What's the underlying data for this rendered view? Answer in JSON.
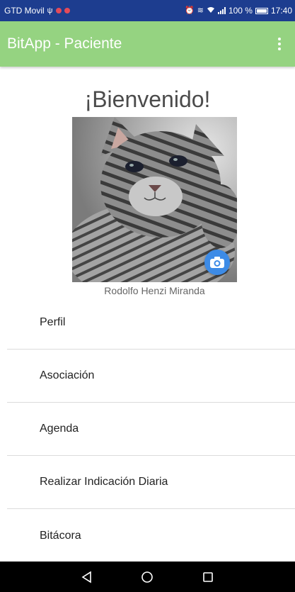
{
  "status_bar": {
    "carrier": "GTD Movil",
    "battery": "100 %",
    "time": "17:40"
  },
  "app_bar": {
    "title": "BitApp - Paciente"
  },
  "profile": {
    "welcome": "¡Bienvenido!",
    "user_name": "Rodolfo Henzi Miranda"
  },
  "menu": {
    "items": [
      {
        "label": "Perfil"
      },
      {
        "label": "Asociación"
      },
      {
        "label": "Agenda"
      },
      {
        "label": "Realizar Indicación Diaria"
      },
      {
        "label": "Bitácora"
      }
    ]
  },
  "colors": {
    "app_bar": "#95d381",
    "status_bar": "#1d3d8f",
    "camera_button": "#3d8be6"
  }
}
